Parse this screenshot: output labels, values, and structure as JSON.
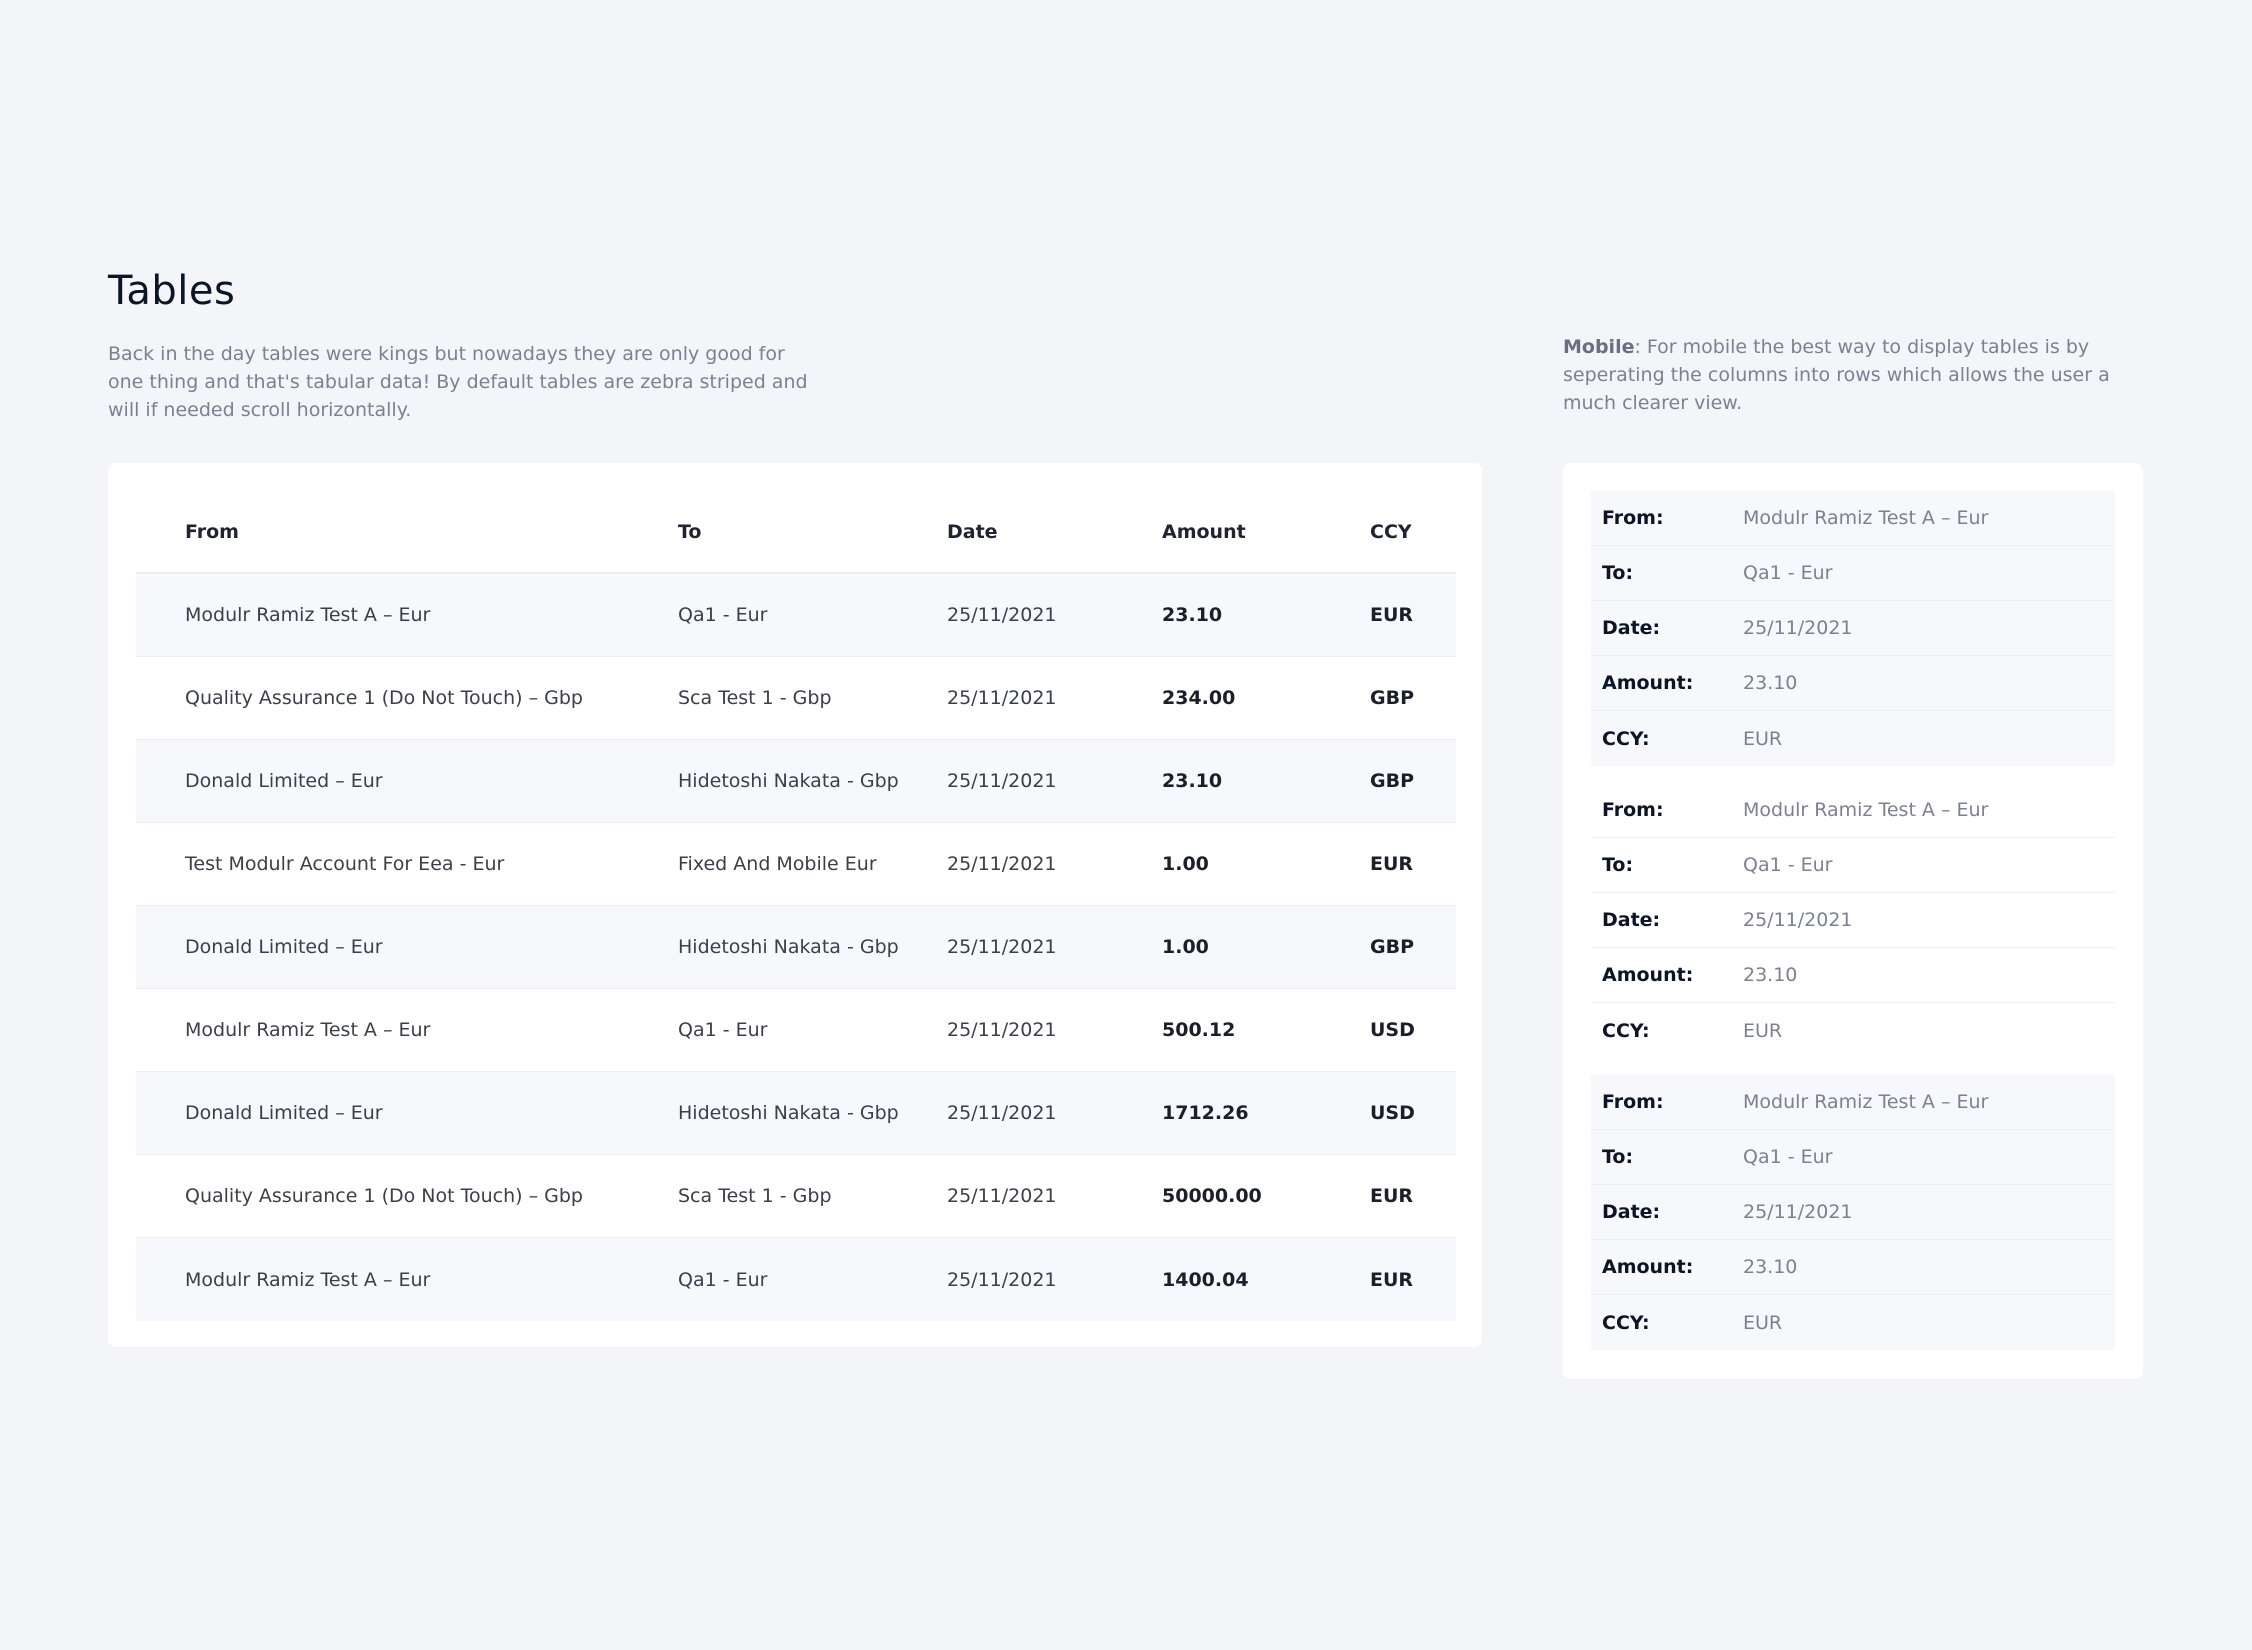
{
  "title": "Tables",
  "intro": "Back in the day tables were kings but nowadays they are only good for one thing and that's tabular data! By default tables are zebra striped and will if needed scroll horizontally.",
  "mobile_note": {
    "bold": "Mobile",
    "text": ": For mobile the best way to display tables is by seperating the columns into rows which allows the user a much clearer view."
  },
  "table": {
    "headers": {
      "from": "From",
      "to": "To",
      "date": "Date",
      "amount": "Amount",
      "ccy": "CCY"
    },
    "rows": [
      {
        "from": "Modulr Ramiz Test A – Eur",
        "to": "Qa1 - Eur",
        "date": "25/11/2021",
        "amount": "23.10",
        "ccy": "EUR"
      },
      {
        "from": "Quality Assurance 1 (Do Not Touch) – Gbp",
        "to": "Sca Test 1 - Gbp",
        "date": "25/11/2021",
        "amount": "234.00",
        "ccy": "GBP"
      },
      {
        "from": "Donald Limited – Eur",
        "to": "Hidetoshi Nakata - Gbp",
        "date": "25/11/2021",
        "amount": "23.10",
        "ccy": "GBP"
      },
      {
        "from": "Test Modulr Account For Eea - Eur",
        "to": "Fixed And Mobile Eur",
        "date": "25/11/2021",
        "amount": "1.00",
        "ccy": "EUR"
      },
      {
        "from": "Donald Limited – Eur",
        "to": "Hidetoshi Nakata - Gbp",
        "date": "25/11/2021",
        "amount": "1.00",
        "ccy": "GBP"
      },
      {
        "from": "Modulr Ramiz Test A – Eur",
        "to": "Qa1 - Eur",
        "date": "25/11/2021",
        "amount": "500.12",
        "ccy": "USD"
      },
      {
        "from": "Donald Limited – Eur",
        "to": "Hidetoshi Nakata - Gbp",
        "date": "25/11/2021",
        "amount": "1712.26",
        "ccy": "USD"
      },
      {
        "from": "Quality Assurance 1 (Do Not Touch) – Gbp",
        "to": "Sca Test 1 - Gbp",
        "date": "25/11/2021",
        "amount": "50000.00",
        "ccy": "EUR"
      },
      {
        "from": "Modulr Ramiz Test A – Eur",
        "to": "Qa1 - Eur",
        "date": "25/11/2021",
        "amount": "1400.04",
        "ccy": "EUR"
      }
    ]
  },
  "mobile": {
    "labels": {
      "from": "From:",
      "to": "To:",
      "date": "Date:",
      "amount": "Amount:",
      "ccy": "CCY:"
    },
    "groups": [
      {
        "from": "Modulr Ramiz Test A – Eur",
        "to": "Qa1 - Eur",
        "date": "25/11/2021",
        "amount": "23.10",
        "ccy": "EUR"
      },
      {
        "from": "Modulr Ramiz Test A – Eur",
        "to": "Qa1 - Eur",
        "date": "25/11/2021",
        "amount": "23.10",
        "ccy": "EUR"
      },
      {
        "from": "Modulr Ramiz Test A – Eur",
        "to": "Qa1 - Eur",
        "date": "25/11/2021",
        "amount": "23.10",
        "ccy": "EUR"
      }
    ]
  }
}
